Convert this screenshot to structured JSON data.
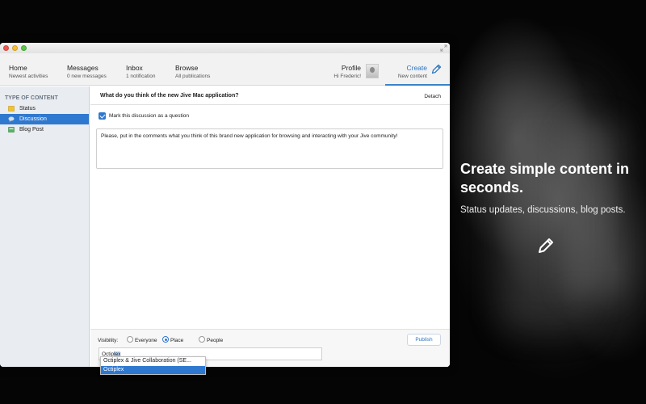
{
  "promo": {
    "title": "Create simple content in seconds.",
    "subtitle": "Status updates, discussions, blog posts."
  },
  "nav": {
    "home": {
      "title": "Home",
      "sub": "Newest activities"
    },
    "messages": {
      "title": "Messages",
      "sub": "0 new messages"
    },
    "inbox": {
      "title": "Inbox",
      "sub": "1 notification"
    },
    "browse": {
      "title": "Browse",
      "sub": "All publications"
    },
    "profile": {
      "title": "Profile",
      "sub": "Hi Frederic!"
    },
    "create": {
      "title": "Create",
      "sub": "New content"
    }
  },
  "sidebar": {
    "heading": "TYPE OF CONTENT",
    "items": [
      {
        "label": "Status",
        "icon": "status-icon"
      },
      {
        "label": "Discussion",
        "icon": "discussion-icon",
        "selected": true
      },
      {
        "label": "Blog Post",
        "icon": "blog-post-icon"
      }
    ]
  },
  "editor": {
    "question": "What do you think of the new Jive Mac application?",
    "detach": "Detach",
    "mark_question_label": "Mark this discussion as a question",
    "mark_question_checked": true,
    "body": "Please, put in the comments what you think of this brand new application for browsing and interacting with your Jive community!"
  },
  "footer": {
    "visibility_label": "Visibility:",
    "options": [
      "Everyone",
      "Place",
      "People"
    ],
    "selected_option": "Place",
    "publish": "Publish",
    "place_typed": "Octip",
    "place_autocomplete": "lex"
  },
  "autocomplete": {
    "items": [
      "Octiplex & Jive Collaboration (SE...",
      "Octiplex"
    ],
    "highlighted": "Octiplex"
  },
  "colors": {
    "accent": "#2f78cf",
    "link": "#2b74c2",
    "sidebar_bg": "#e9ecf0"
  }
}
